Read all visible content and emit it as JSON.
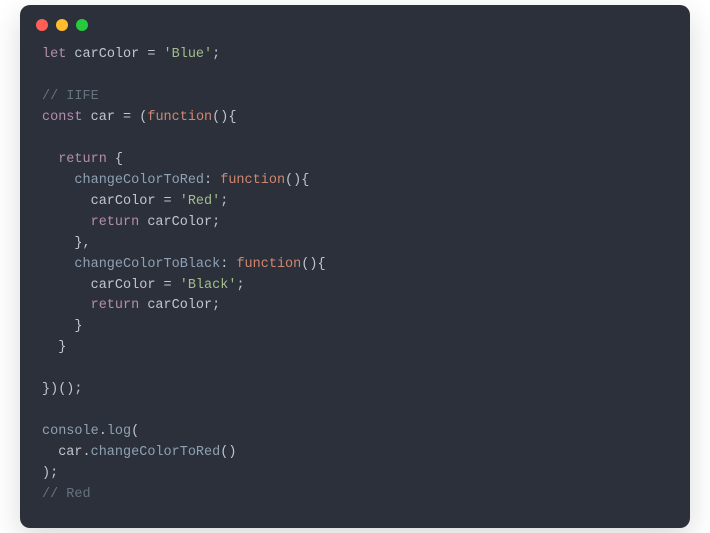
{
  "titlebar": {
    "dots": [
      "red",
      "yellow",
      "green"
    ]
  },
  "colors": {
    "background": "#2b303b",
    "keyword": "#b48ead",
    "function_kw": "#d08770",
    "identifier": "#c0c5ce",
    "property": "#8fa1b3",
    "string": "#a3be8c",
    "comment": "#65737e"
  },
  "code": {
    "l01_let": "let",
    "l01_var": " carColor ",
    "l01_eq": "= ",
    "l01_str": "'Blue'",
    "l01_semi": ";",
    "l03_comment": "// IIFE",
    "l04_const": "const",
    "l04_var": " car ",
    "l04_eq": "= (",
    "l04_func": "function",
    "l04_paren": "(){",
    "l06_return": "  return",
    "l06_brace": " {",
    "l07_indent": "    ",
    "l07_prop": "changeColorToRed",
    "l07_colon": ": ",
    "l07_func": "function",
    "l07_paren": "(){",
    "l08_indent": "      carColor = ",
    "l08_str": "'Red'",
    "l08_semi": ";",
    "l09_indent": "      ",
    "l09_return": "return",
    "l09_rest": " carColor;",
    "l10_close": "    },",
    "l11_indent": "    ",
    "l11_prop": "changeColorToBlack",
    "l11_colon": ": ",
    "l11_func": "function",
    "l11_paren": "(){",
    "l12_indent": "      carColor = ",
    "l12_str": "'Black'",
    "l12_semi": ";",
    "l13_indent": "      ",
    "l13_return": "return",
    "l13_rest": " carColor;",
    "l14_close": "    }",
    "l15_close": "  }",
    "l17_close": "})();",
    "l19_console": "console",
    "l19_dot": ".",
    "l19_log": "log",
    "l19_paren": "(",
    "l20_indent": "  car.",
    "l20_method": "changeColorToRed",
    "l20_paren": "()",
    "l21_close": ");",
    "l22_comment": "// Red"
  }
}
